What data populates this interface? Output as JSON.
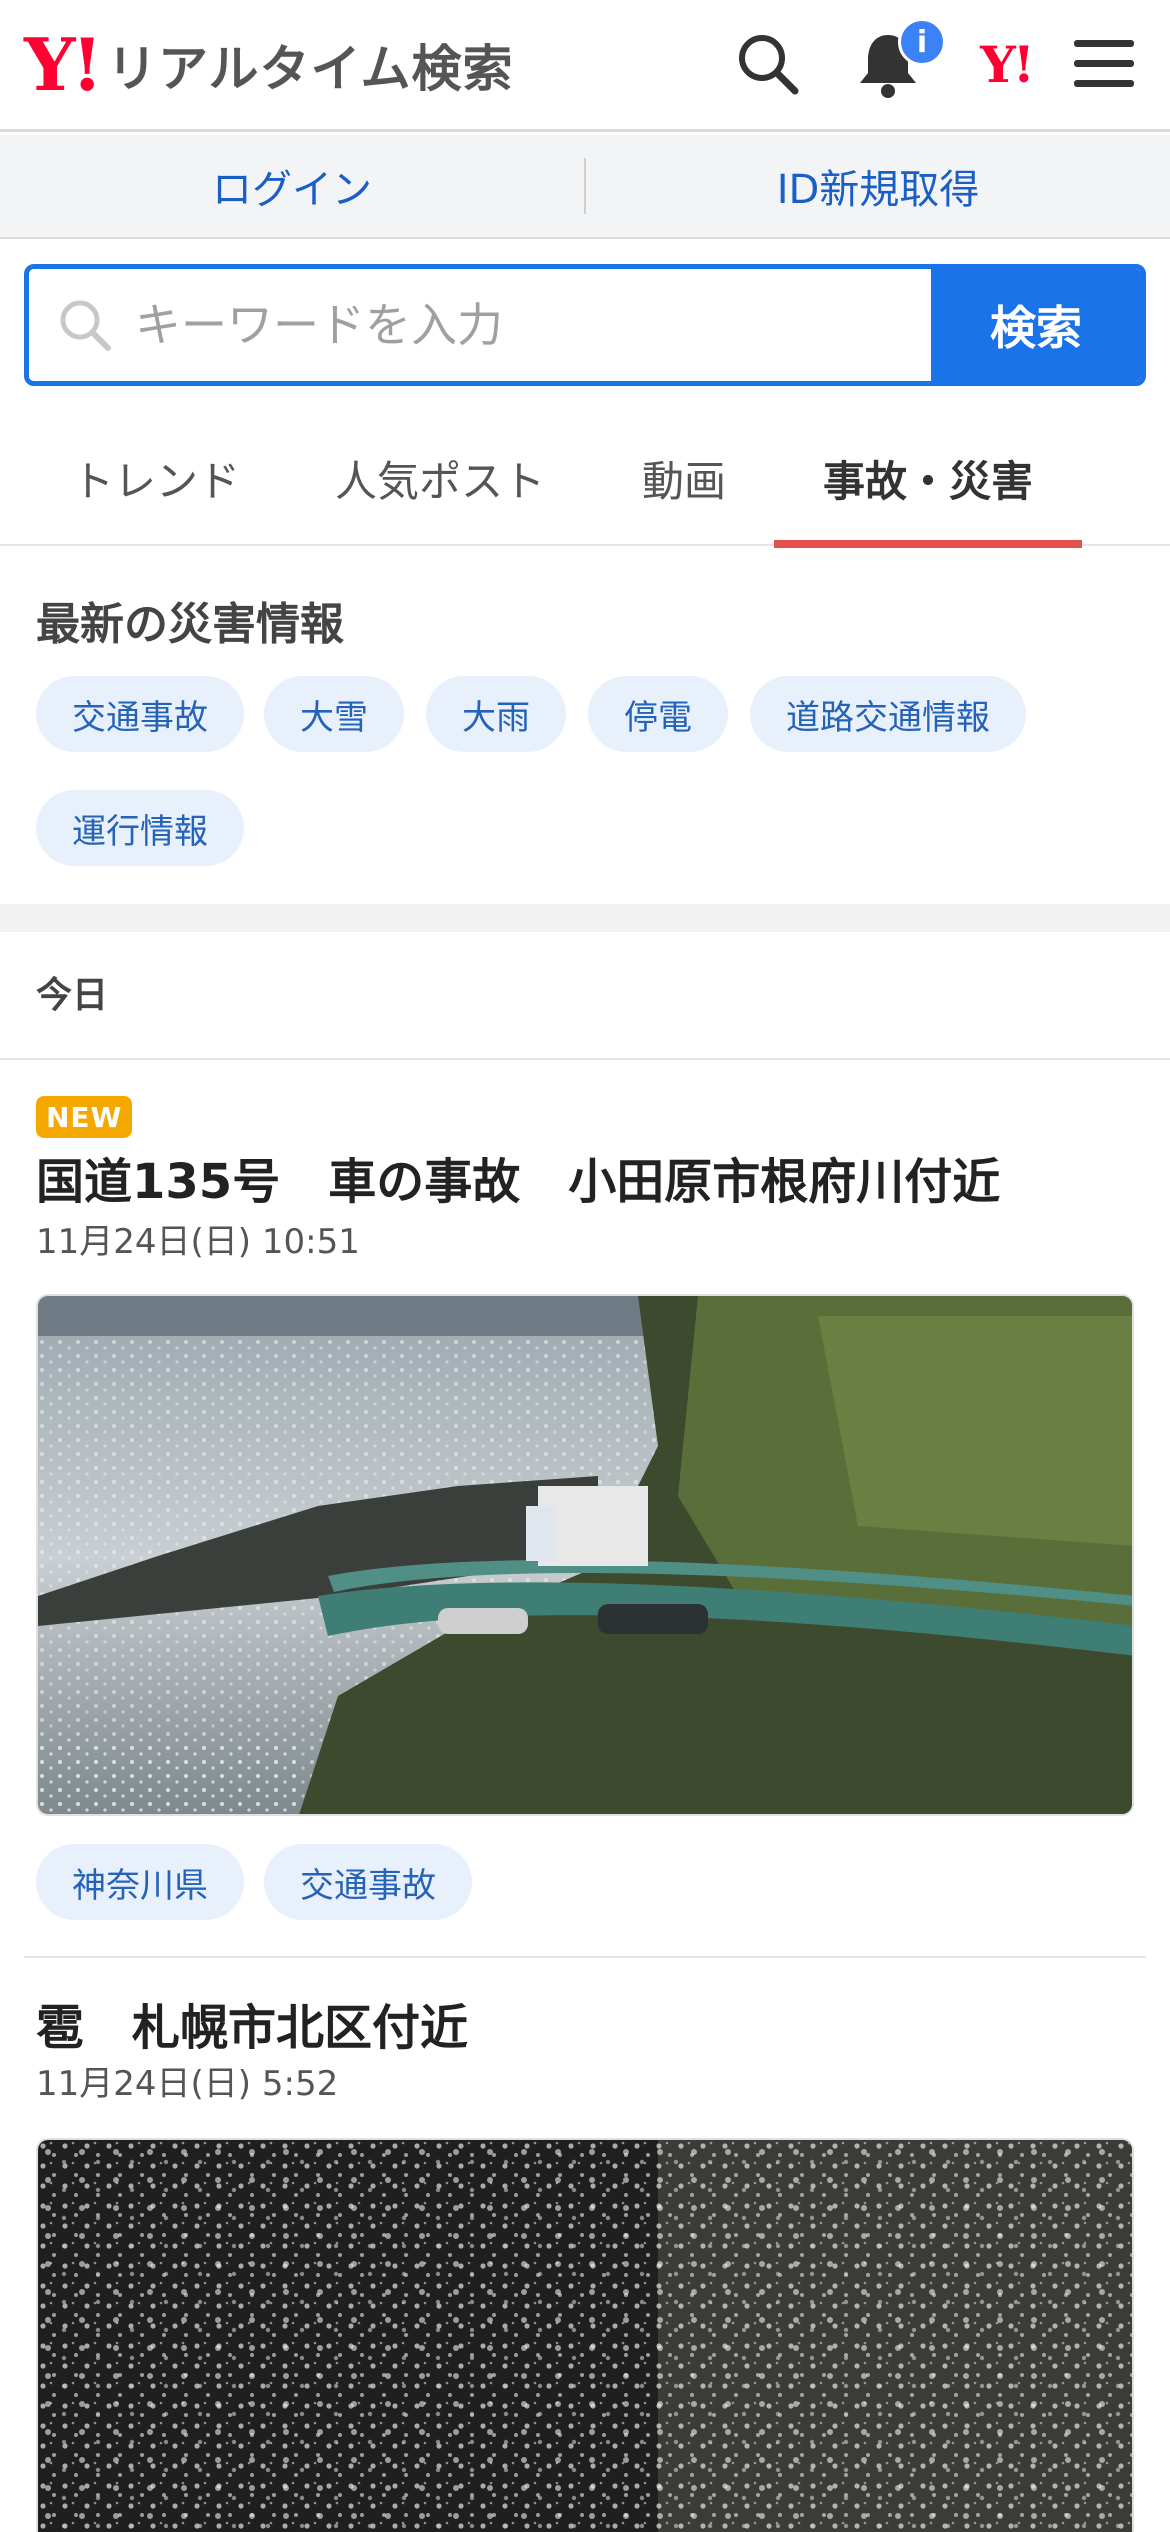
{
  "header": {
    "logo_mark": "Y!",
    "logo_text": "リアルタイム検索",
    "notification_badge": "i",
    "yj_mark": "Y!"
  },
  "auth": {
    "login_label": "ログイン",
    "signup_label": "ID新規取得"
  },
  "search": {
    "placeholder": "キーワードを入力",
    "button_label": "検索"
  },
  "tabs": [
    {
      "label": "トレンド",
      "active": false
    },
    {
      "label": "人気ポスト",
      "active": false
    },
    {
      "label": "動画",
      "active": false
    },
    {
      "label": "事故・災害",
      "active": true
    }
  ],
  "disaster": {
    "title": "最新の災害情報",
    "chips": [
      "交通事故",
      "大雪",
      "大雨",
      "停電",
      "道路交通情報",
      "運行情報"
    ]
  },
  "today_label": "今日",
  "posts": [
    {
      "badge": "NEW",
      "title": "国道135号　車の事故　小田原市根府川付近",
      "time": "11月24日(日) 10:51",
      "tags": [
        "神奈川県",
        "交通事故"
      ]
    },
    {
      "title": "雹　札幌市北区付近",
      "time": "11月24日(日) 5:52"
    }
  ],
  "colors": {
    "accent": "#1a73e8",
    "brand": "#ff0033",
    "tab_underline": "#e0524a",
    "chip_bg": "#e8f0fc",
    "chip_text": "#2563b8",
    "new_badge": "#f5a800"
  }
}
